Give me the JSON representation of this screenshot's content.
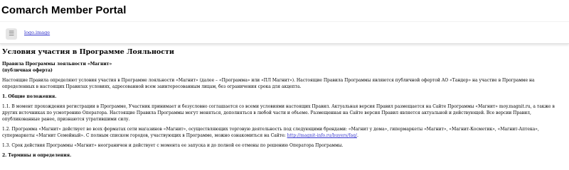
{
  "header": {
    "title": "Comarch Member Portal",
    "menu_icon": "☰",
    "logo_text": "logo.image"
  },
  "content": {
    "heading": "Условия участия в Программе Лояльности",
    "rules_title": "Правила Программы лояльности «Магнит»",
    "rules_subtitle": "(публичная оферта)",
    "intro": "Настоящие Правила определяют условия участия в Программе лояльности «Магнит» (далее – «Программа» или «ПЛ Магнит»). Настоящие Правила Программы являются публичной офертой АО «Тандер» на участие в Программе на определенных в настоящих Правилах условиях, адресованной всем заинтересованным лицам, без ограничения срока для акцепта.",
    "section1_title": "1. Общие положения.",
    "p1_1": "1.1. В момент прохождения регистрации в Программе, Участник принимает и безусловно соглашается со всеми условиями настоящих Правил. Актуальная версия Правил размещается на Сайте Программы «Магнит» moy.magnit.ru, а также в других источниках по усмотрению Оператора. Настоящие Правила Программы могут меняться, дополняться в любой части и объеме. Размещенная на Сайте версия Правил является актуальной и действующей. Все версии Правил, опубликованные ранее, признаются утратившими силу.",
    "p1_2_text": "1.2. Программа «Магнит» действует во всех форматах сети магазинов «Магнит», осуществляющих торговую деятельность под следующими брендами: «Магнит у дома», гипермаркеты «Магнит», «Магнит-Косметик», «Магнит-Аптека», супермаркеты «Магнит Семейный». С полным списком городов, участвующих в Программе, можно ознакомиться на Сайте: ",
    "p1_2_link": "http://magnit-info.ru/buyers/faq/",
    "p1_2_end": ".",
    "p1_3": "1.3. Срок действия Программы «Магнит» неограничен и действует с момента ее запуска и до полной ее отмены по решению Оператора Программы.",
    "section2_title": "2. Термины и определения."
  }
}
